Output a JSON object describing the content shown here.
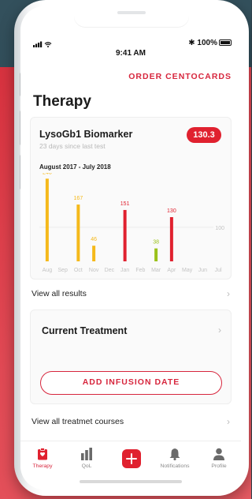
{
  "status_bar": {
    "time": "9:41 AM",
    "battery": "100%",
    "bluetooth": "✱"
  },
  "header": {
    "order_link": "ORDER CENTOCARDS",
    "title": "Therapy"
  },
  "biomarker_card": {
    "title": "LysoGb1 Biomarker",
    "subtitle": "23 days since last test",
    "badge_value": "130.3",
    "range_label": "August 2017 - July 2018"
  },
  "chart_data": {
    "type": "bar",
    "categories": [
      "Aug",
      "Sep",
      "Oct",
      "Nov",
      "Dec",
      "Jan",
      "Feb",
      "Mar",
      "Apr",
      "May",
      "Jun",
      "Jul"
    ],
    "values": [
      243,
      null,
      167,
      46,
      null,
      151,
      null,
      38,
      130,
      null,
      null,
      null
    ],
    "data_labels": [
      "243",
      "",
      "167",
      "46",
      "",
      "151",
      "",
      "38",
      "130",
      "",
      "",
      ""
    ],
    "bar_colors": [
      "#f5b91b",
      null,
      "#f5b91b",
      "#f5b91b",
      null,
      "#e0212f",
      null,
      "#9ac11a",
      "#e0212f",
      null,
      null,
      null
    ],
    "reference_line": {
      "value": 100,
      "label": "100"
    },
    "ylim": [
      0,
      260
    ]
  },
  "links": {
    "view_all_results": "View all results",
    "view_all_courses": "View all treatmet courses"
  },
  "treatment_card": {
    "title": "Current Treatment",
    "add_button": "ADD INFUSION DATE"
  },
  "tabbar": {
    "items": [
      {
        "label": "Therapy",
        "icon": "clipboard-icon",
        "active": true
      },
      {
        "label": "QoL",
        "icon": "bar-chart-icon",
        "active": false
      },
      {
        "label": "",
        "icon": "plus-icon",
        "active": false
      },
      {
        "label": "Notifications",
        "icon": "bell-icon",
        "active": false
      },
      {
        "label": "Profile",
        "icon": "person-icon",
        "active": false
      }
    ]
  },
  "colors": {
    "accent": "#e0212f",
    "yellow": "#f5b91b",
    "green": "#9ac11a"
  }
}
